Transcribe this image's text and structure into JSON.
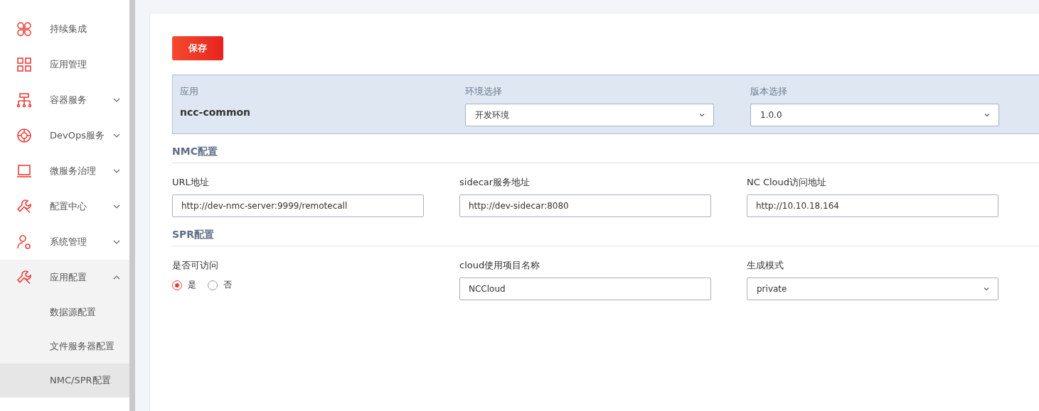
{
  "sidebar": {
    "items": [
      {
        "label": "持续集成"
      },
      {
        "label": "应用管理"
      },
      {
        "label": "容器服务",
        "expanded": false
      },
      {
        "label": "DevOps服务",
        "expanded": false
      },
      {
        "label": "微服务治理",
        "expanded": false
      },
      {
        "label": "配置中心",
        "expanded": false
      },
      {
        "label": "系统管理",
        "expanded": false
      },
      {
        "label": "应用配置",
        "expanded": true,
        "children": [
          {
            "label": "数据源配置",
            "selected": false
          },
          {
            "label": "文件服务器配置",
            "selected": false
          },
          {
            "label": "NMC/SPR配置",
            "selected": true
          }
        ]
      }
    ]
  },
  "save_button": "保存",
  "app_panel": {
    "app_label": "应用",
    "app_name": "ncc-common",
    "selects": [
      {
        "label": "环境选择",
        "value": "开发环境"
      },
      {
        "label": "版本选择",
        "value": "1.0.0"
      }
    ]
  },
  "sections": [
    {
      "title": "NMC配置",
      "fields": [
        {
          "kind": "input",
          "label": "URL地址",
          "value": "http://dev-nmc-server:9999/remotecall"
        },
        {
          "kind": "input",
          "label": "sidecar服务地址",
          "value": "http://dev-sidecar:8080"
        },
        {
          "kind": "input",
          "label": "NC Cloud访问地址",
          "value": "http://10.10.18.164"
        }
      ]
    },
    {
      "title": "SPR配置",
      "fields": [
        {
          "kind": "radio",
          "label": "是否可访问",
          "options": [
            {
              "label": "是",
              "selected": true
            },
            {
              "label": "否",
              "selected": false
            }
          ]
        },
        {
          "kind": "input",
          "label": "cloud使用项目名称",
          "value": "NCCloud"
        },
        {
          "kind": "select",
          "label": "生成模式",
          "value": "private"
        }
      ]
    }
  ]
}
